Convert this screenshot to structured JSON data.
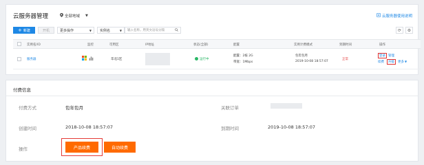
{
  "header": {
    "title": "云服务器管理",
    "region": "全部地域",
    "doc_link": "云服务器使用说明"
  },
  "toolbar": {
    "new_button": "新建",
    "grey_button": "开机",
    "more_ops": "更多操作",
    "search_field": "实例名",
    "search_placeholder": "输入名称，用英文逗号分隔"
  },
  "table": {
    "columns": [
      "实例名/ID",
      "监控",
      "可用区",
      "IP地址",
      "状态(全部)",
      "配置",
      "实例计费模式",
      "到期时间",
      "操作"
    ],
    "row": {
      "name": "服务器",
      "zone": "华北1区",
      "status": "运行中",
      "config_line1": "配置：2核 2G",
      "config_line2": "带宽：1Mbps",
      "billing": "包年包月",
      "billing_time": "2019-10-08 18:57:07",
      "expire": "正常",
      "ops": {
        "login": "登录",
        "manage": "管理",
        "renew": "续费",
        "upgrade": "升级",
        "more": "更多"
      }
    }
  },
  "billing_info": {
    "title": "付费信息",
    "pay_mode_label": "付费方式",
    "pay_mode_value": "包年包月",
    "order_label": "关联订单",
    "created_label": "创建时间",
    "created_value": "2018-10-08 18:57:07",
    "expire_label": "到期时间",
    "expire_value": "2019-10-08 18:57:07",
    "ops_label": "操作",
    "renew_button": "产品续费",
    "auto_renew_button": "自动续费"
  },
  "colors": {
    "accent": "#1e88e5",
    "orange": "#ff6a00",
    "highlight": "#e53935",
    "running": "#29b766"
  }
}
